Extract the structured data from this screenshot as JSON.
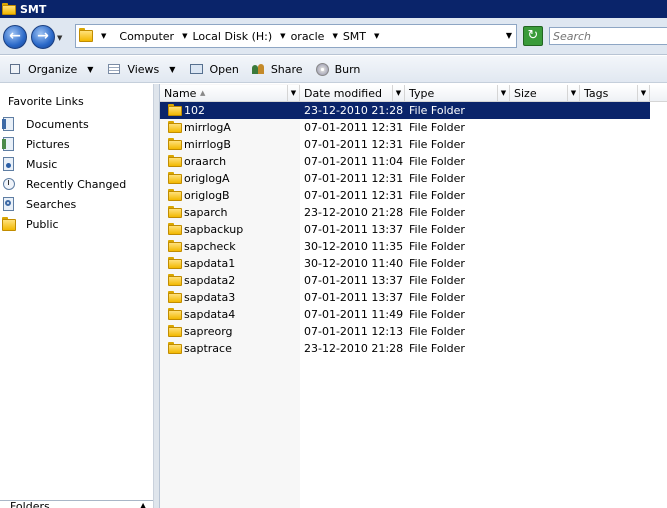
{
  "window": {
    "title": "SMT"
  },
  "address": {
    "crumbs": [
      "Computer",
      "Local Disk (H:)",
      "oracle",
      "SMT"
    ],
    "search_placeholder": "Search"
  },
  "toolbar": {
    "organize": "Organize",
    "views": "Views",
    "open": "Open",
    "share": "Share",
    "burn": "Burn"
  },
  "sidebar": {
    "title": "Favorite Links",
    "items": [
      {
        "label": "Documents",
        "icon": "documents-icon"
      },
      {
        "label": "Pictures",
        "icon": "pictures-icon"
      },
      {
        "label": "Music",
        "icon": "music-icon"
      },
      {
        "label": "Recently Changed",
        "icon": "recently-changed-icon"
      },
      {
        "label": "Searches",
        "icon": "searches-icon"
      },
      {
        "label": "Public",
        "icon": "public-folder-icon"
      }
    ],
    "folders_label": "Folders"
  },
  "columns": [
    "Name",
    "Date modified",
    "Type",
    "Size",
    "Tags"
  ],
  "files": [
    {
      "name": "102",
      "date": "23-12-2010 21:28",
      "type": "File Folder"
    },
    {
      "name": "mirrlogA",
      "date": "07-01-2011 12:31",
      "type": "File Folder"
    },
    {
      "name": "mirrlogB",
      "date": "07-01-2011 12:31",
      "type": "File Folder"
    },
    {
      "name": "oraarch",
      "date": "07-01-2011 11:04",
      "type": "File Folder"
    },
    {
      "name": "origlogA",
      "date": "07-01-2011 12:31",
      "type": "File Folder"
    },
    {
      "name": "origlogB",
      "date": "07-01-2011 12:31",
      "type": "File Folder"
    },
    {
      "name": "saparch",
      "date": "23-12-2010 21:28",
      "type": "File Folder"
    },
    {
      "name": "sapbackup",
      "date": "07-01-2011 13:37",
      "type": "File Folder"
    },
    {
      "name": "sapcheck",
      "date": "30-12-2010 11:35",
      "type": "File Folder"
    },
    {
      "name": "sapdata1",
      "date": "30-12-2010 11:40",
      "type": "File Folder"
    },
    {
      "name": "sapdata2",
      "date": "07-01-2011 13:37",
      "type": "File Folder"
    },
    {
      "name": "sapdata3",
      "date": "07-01-2011 13:37",
      "type": "File Folder"
    },
    {
      "name": "sapdata4",
      "date": "07-01-2011 11:49",
      "type": "File Folder"
    },
    {
      "name": "sapreorg",
      "date": "07-01-2011 12:13",
      "type": "File Folder"
    },
    {
      "name": "saptrace",
      "date": "23-12-2010 21:28",
      "type": "File Folder"
    }
  ],
  "selected_index": 0,
  "colors": {
    "titlebar": "#0a246a",
    "selection": "#0a246a",
    "folder": "#f2b800"
  }
}
